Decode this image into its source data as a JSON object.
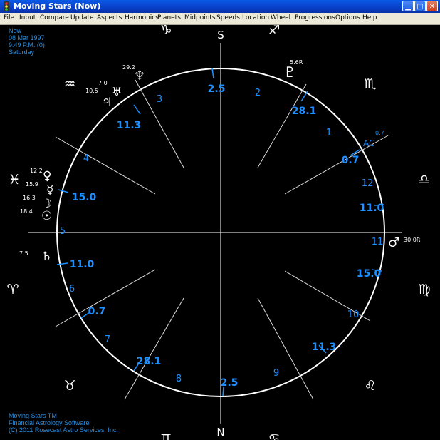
{
  "window": {
    "title": "Moving Stars (Now)"
  },
  "menu": [
    "File",
    "Input",
    "Compare",
    "Update",
    "Aspects",
    "Harmonics",
    "Planets",
    "Midpoints",
    "Speeds",
    "Location",
    "Wheel",
    "Progressions",
    "Options",
    "Help"
  ],
  "info": {
    "name": "Now",
    "date": "08 Mar 1997",
    "time": "9:49 P.M. (0)",
    "weekday": "Saturday"
  },
  "footer": {
    "line1": "Moving Stars TM",
    "line2": "Financial Astrology Software",
    "line3": "(C) 2011 Rosecast Astro Services, Inc."
  },
  "colors": {
    "accent": "#1e90ff",
    "background": "#000000",
    "lines": "#ffffff"
  },
  "wheel": {
    "compass": {
      "south": "S",
      "north": "N"
    },
    "zodiac_signs": [
      "aries",
      "taurus",
      "gemini",
      "cancer",
      "leo",
      "virgo",
      "libra",
      "scorpio",
      "sagittarius",
      "capricorn",
      "aquarius",
      "pisces"
    ],
    "zodiac_glyphs": [
      "♈",
      "♉",
      "♊",
      "♋",
      "♌",
      "♍",
      "♎",
      "♏",
      "♐",
      "♑",
      "♒",
      "♓"
    ],
    "house_numbers": [
      "1",
      "2",
      "3",
      "4",
      "5",
      "6",
      "7",
      "8",
      "9",
      "10",
      "11",
      "12"
    ],
    "cusp_degrees": [
      "2.5",
      "28.1",
      "11.3",
      "0.7",
      "15.0",
      "11.0",
      "11.0",
      "15.0",
      "0.7",
      "11.3",
      "28.1",
      "2.5"
    ],
    "ascendant": {
      "label": "AC",
      "degree": "0.7"
    },
    "planets": [
      {
        "name": "pluto",
        "glyph": "♇",
        "degree": "5.6R"
      },
      {
        "name": "neptune",
        "glyph": "♆",
        "degree": "29.2"
      },
      {
        "name": "uranus",
        "glyph": "♅",
        "degree": "7.0"
      },
      {
        "name": "jupiter",
        "glyph": "♃",
        "degree": "10.5"
      },
      {
        "name": "venus",
        "glyph": "♀",
        "degree": "12.2"
      },
      {
        "name": "mercury",
        "glyph": "☿",
        "degree": "15.9"
      },
      {
        "name": "moon",
        "glyph": "☽",
        "degree": "16.3"
      },
      {
        "name": "sun",
        "glyph": "☉",
        "degree": "18.4"
      },
      {
        "name": "saturn",
        "glyph": "♄",
        "degree": "7.5"
      },
      {
        "name": "mars",
        "glyph": "♂",
        "degree": "30.0R"
      }
    ]
  }
}
